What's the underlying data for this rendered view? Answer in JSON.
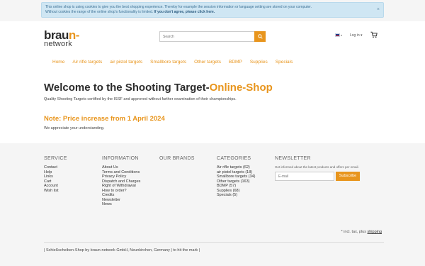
{
  "cookie": {
    "line1": "This online shop is using cookies to give you the best shopping experience. Thereby for example the session information or language setting are stored on your computer.",
    "line2_prefix": "Without cookies the range of the online shop's functionality is limited. ",
    "line2_link": "If you don't agree, please click here.",
    "close": "×"
  },
  "logo": {
    "part1": "brau",
    "part1_accent": "n",
    "part1_dash": "-",
    "part2": "network"
  },
  "search": {
    "placeholder": "Search",
    "icon": "search-icon"
  },
  "header": {
    "language": "english-flag",
    "login": "Log in",
    "login_caret": "▾",
    "cart_icon": "cart-icon"
  },
  "nav": [
    "Home",
    "Air rifle targets",
    "air pistol targets",
    "Smallbore targets",
    "Other targets",
    "BDMP",
    "Supplies",
    "Specials"
  ],
  "main": {
    "title_part1": "Welcome to the Shooting Target-",
    "title_part2": "Online-Shop",
    "subtitle": "Quality Shooting Targets certified by the ISSF and approved without further examination of their championships.",
    "note": "Note: Price increase from 1 April 2024",
    "note_text": "We appreciate your understanding."
  },
  "footer": {
    "service": {
      "heading": "SERVICE",
      "items": [
        "Contact",
        "Help",
        "Links",
        "Cart",
        "Account",
        "Wish list"
      ]
    },
    "information": {
      "heading": "INFORMATION",
      "items": [
        "About Us",
        "Terms and Conditions",
        "Privacy Policy",
        "Dispatch and Charges",
        "Right of Withdrawal",
        "How to order?",
        "Credits",
        "Newsletter",
        "News"
      ]
    },
    "brands": {
      "heading": "OUR BRANDS"
    },
    "categories": {
      "heading": "CATEGORIES",
      "items": [
        "Air rifle targets (62)",
        "air pistol targets (18)",
        "Smallbore targets (34)",
        "Other targets (163)",
        "BDMP (57)",
        "Supplies (68)",
        "Specials (5)"
      ]
    },
    "newsletter": {
      "heading": "NEWSLETTER",
      "description": "Get informed about the latest products and offers per email.",
      "placeholder": "E-mail",
      "button": "Subscribe"
    },
    "vat_prefix": "* incl. tax, plus ",
    "vat_link": "shipping",
    "bottom": "| Schießscheiben-Shop by braun-network GmbH, Neunkirchen, Germany | to hit the mark |"
  },
  "colors": {
    "accent": "#e8951d",
    "cookie_bg": "#cfe6f3",
    "text": "#333333"
  }
}
